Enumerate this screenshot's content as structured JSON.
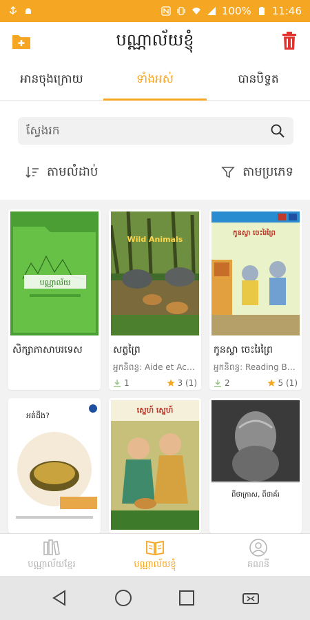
{
  "status": {
    "battery": "100%",
    "time": "11:46"
  },
  "appbar": {
    "title": "បណ្ណាល័យខ្ញុំ"
  },
  "tabs": [
    {
      "label": "អានចុងក្រោយ",
      "active": false
    },
    {
      "label": "ទាំងអស់",
      "active": true
    },
    {
      "label": "បានបិទ្វត",
      "active": false
    }
  ],
  "search": {
    "placeholder": "ស្វែងរក"
  },
  "tools": {
    "sort_label": "តាមលំដាប់",
    "filter_label": "តាមប្រភេទ"
  },
  "books": [
    {
      "title": "សិក្សាភាសាបរទេស",
      "author": "",
      "downloads": "",
      "rating": ""
    },
    {
      "title": "សត្វព្រៃ",
      "author": "អ្នកនិពន្ធ: Aide et Acti...",
      "downloads": "1",
      "rating": "3 (1)"
    },
    {
      "title": "កូនស្វា ចេះរៃព្រៃ",
      "author": "អ្នកនិពន្ធ: Reading Bo...",
      "downloads": "2",
      "rating": "5 (1)"
    },
    {
      "title": "",
      "author": "",
      "downloads": "",
      "rating": ""
    },
    {
      "title": "",
      "author": "",
      "downloads": "",
      "rating": ""
    },
    {
      "title": "",
      "author": "",
      "downloads": "",
      "rating": ""
    }
  ],
  "covers": {
    "c1_text": "បណ្ណាល័យ",
    "c2_text": "Wild Animals",
    "c3_text": "កូនស្វា ចេះរៃព្រៃ",
    "c4_text": "អត់ដឹង?",
    "c5_text": "ស្នេហ៍ ស្នេហ៍",
    "c6_text": "ពីថាក្រាស, ពីថាគ័រ"
  },
  "bottomnav": [
    {
      "label": "បណ្ណាល័យខ្មែរ",
      "active": false
    },
    {
      "label": "បណ្ណាល័យខ្ញុំ",
      "active": true
    },
    {
      "label": "គណនី",
      "active": false
    }
  ],
  "colors": {
    "accent": "#f5a623",
    "danger": "#e0322f",
    "folder": "#f5a623"
  }
}
